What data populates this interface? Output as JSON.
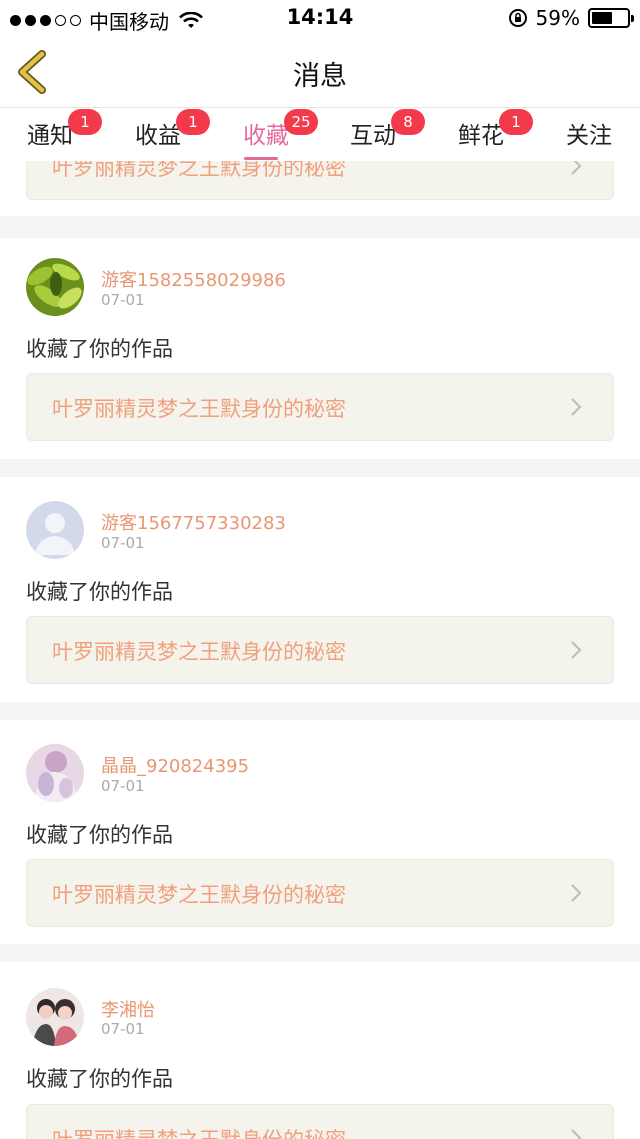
{
  "status_bar": {
    "carrier": "中国移动",
    "time": "14:14",
    "battery": "59%",
    "battery_level": 0.59
  },
  "header": {
    "title": "消息"
  },
  "tabs": [
    {
      "label": "通知",
      "badge": "1",
      "active": false
    },
    {
      "label": "收益",
      "badge": "1",
      "active": false
    },
    {
      "label": "收藏",
      "badge": "25",
      "active": true
    },
    {
      "label": "互动",
      "badge": "8",
      "active": false
    },
    {
      "label": "鲜花",
      "badge": "1",
      "active": false
    },
    {
      "label": "关注",
      "badge": "",
      "active": false
    }
  ],
  "feed": {
    "partial_top_work_title": "叶罗丽精灵梦之王默身份的秘密",
    "items": [
      {
        "username": "游客1582558029986",
        "date": "07-01",
        "action": "收藏了你的作品",
        "work_title": "叶罗丽精灵梦之王默身份的秘密",
        "avatar": "plant-photo"
      },
      {
        "username": "游客1567757330283",
        "date": "07-01",
        "action": "收藏了你的作品",
        "work_title": "叶罗丽精灵梦之王默身份的秘密",
        "avatar": "default-person"
      },
      {
        "username": "晶晶_920824395",
        "date": "07-01",
        "action": "收藏了你的作品",
        "work_title": "叶罗丽精灵梦之王默身份的秘密",
        "avatar": "anime-photo"
      },
      {
        "username": "李湘怡",
        "date": "07-01",
        "action": "收藏了你的作品",
        "work_title": "叶罗丽精灵梦之王默身份的秘密",
        "avatar": "couple-photo"
      }
    ]
  },
  "colors": {
    "accent": "#e5699c",
    "badge": "#f33a4a",
    "username": "#e99772",
    "work_title": "#f0a07d",
    "back_arrow": "#c9a63a"
  }
}
